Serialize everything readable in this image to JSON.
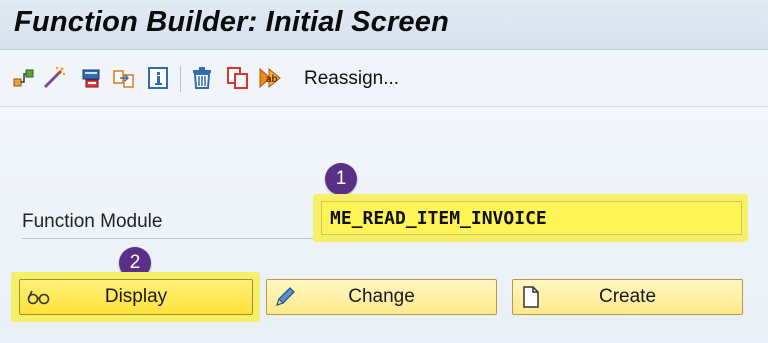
{
  "window": {
    "title": "Function Builder: Initial Screen"
  },
  "toolbar": {
    "icons": [
      "hierarchy-icon",
      "wand-icon",
      "test-icon",
      "copy-icon",
      "info-icon",
      "delete-icon",
      "duplicate-icon",
      "rename-icon"
    ],
    "reassign_label": "Reassign..."
  },
  "form": {
    "field_label": "Function Module",
    "field_value": "ME_READ_ITEM_INVOICE"
  },
  "annotations": {
    "step1": "1",
    "step2": "2"
  },
  "buttons": {
    "display": "Display",
    "change": "Change",
    "create": "Create"
  },
  "colors": {
    "highlight": "#f5ef6a",
    "badge": "#5a2f88",
    "button": "#ffe98a"
  }
}
